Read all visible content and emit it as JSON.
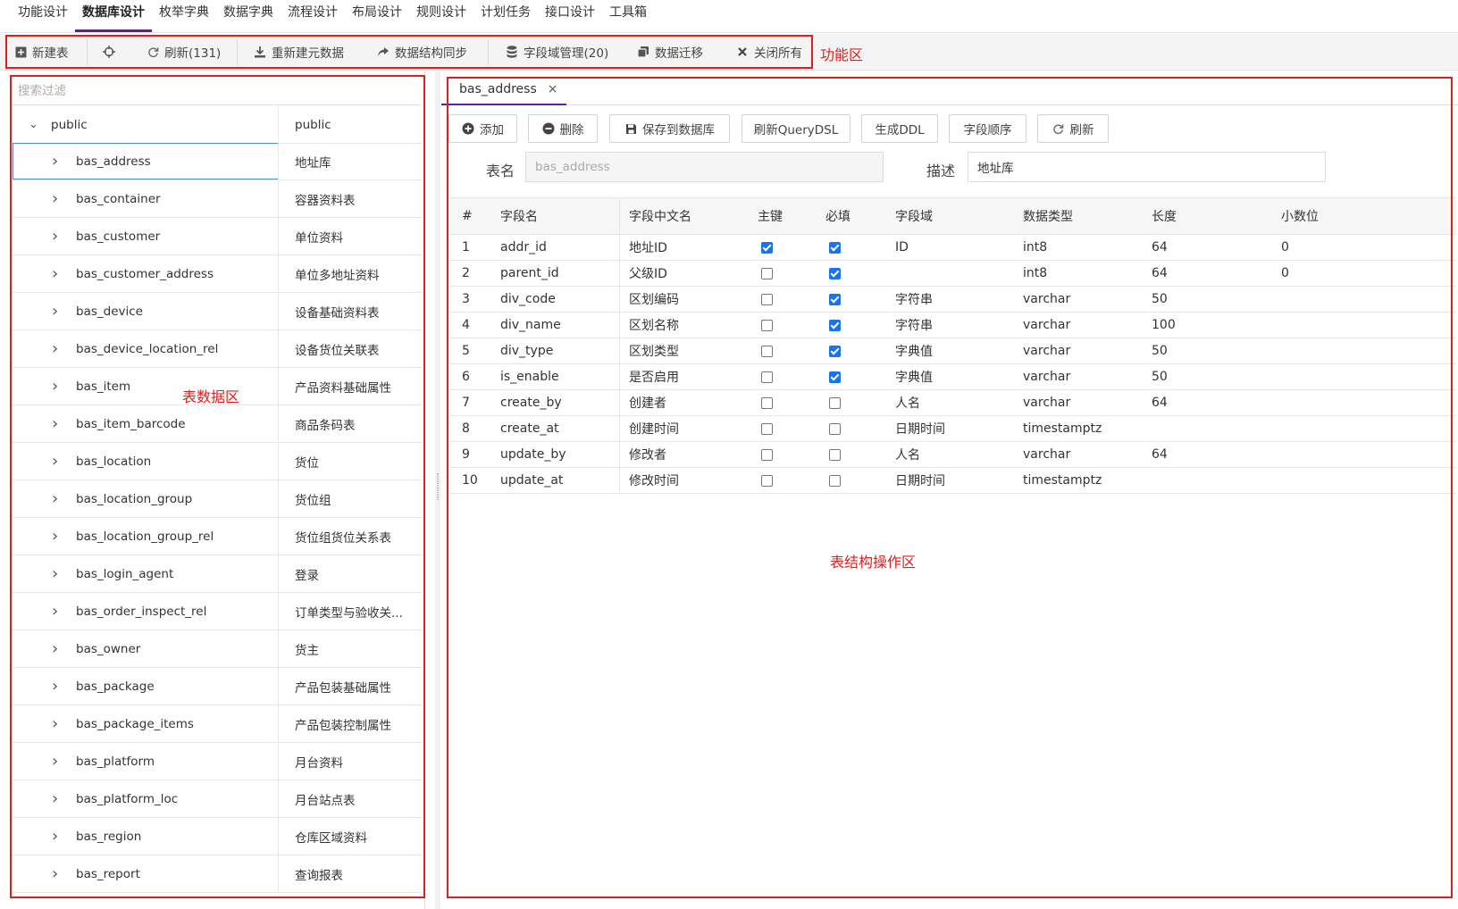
{
  "menu": [
    {
      "label": "功能设计",
      "active": false
    },
    {
      "label": "数据库设计",
      "active": true
    },
    {
      "label": "枚举字典",
      "active": false
    },
    {
      "label": "数据字典",
      "active": false
    },
    {
      "label": "流程设计",
      "active": false
    },
    {
      "label": "布局设计",
      "active": false
    },
    {
      "label": "规则设计",
      "active": false
    },
    {
      "label": "计划任务",
      "active": false
    },
    {
      "label": "接口设计",
      "active": false
    },
    {
      "label": "工具箱",
      "active": false
    }
  ],
  "toolbar": {
    "new_table": "新建表",
    "refresh": "刷新(131)",
    "rebuild_meta": "重新建元数据",
    "sync_structure": "数据结构同步",
    "field_domain": "字段域管理(20)",
    "migrate": "数据迁移",
    "close_all": "关闭所有"
  },
  "annotations": {
    "toolbar_area": "功能区",
    "table_area": "表数据区",
    "structure_area": "表结构操作区"
  },
  "tree": {
    "search_placeholder": "搜索过滤",
    "root": {
      "name": "public",
      "desc": "public"
    },
    "items": [
      {
        "name": "bas_address",
        "desc": "地址库"
      },
      {
        "name": "bas_container",
        "desc": "容器资料表"
      },
      {
        "name": "bas_customer",
        "desc": "单位资料"
      },
      {
        "name": "bas_customer_address",
        "desc": "单位多地址资料"
      },
      {
        "name": "bas_device",
        "desc": "设备基础资料表"
      },
      {
        "name": "bas_device_location_rel",
        "desc": "设备货位关联表"
      },
      {
        "name": "bas_item",
        "desc": "产品资料基础属性"
      },
      {
        "name": "bas_item_barcode",
        "desc": "商品条码表"
      },
      {
        "name": "bas_location",
        "desc": "货位"
      },
      {
        "name": "bas_location_group",
        "desc": "货位组"
      },
      {
        "name": "bas_location_group_rel",
        "desc": "货位组货位关系表"
      },
      {
        "name": "bas_login_agent",
        "desc": "登录"
      },
      {
        "name": "bas_order_inspect_rel",
        "desc": "订单类型与验收关..."
      },
      {
        "name": "bas_owner",
        "desc": "货主"
      },
      {
        "name": "bas_package",
        "desc": "产品包装基础属性"
      },
      {
        "name": "bas_package_items",
        "desc": "产品包装控制属性"
      },
      {
        "name": "bas_platform",
        "desc": "月台资料"
      },
      {
        "name": "bas_platform_loc",
        "desc": "月台站点表"
      },
      {
        "name": "bas_region",
        "desc": "仓库区域资料"
      },
      {
        "name": "bas_report",
        "desc": "查询报表"
      }
    ]
  },
  "editor": {
    "tab_label": "bas_address",
    "tab_close": "×",
    "actions": {
      "add": "添加",
      "delete": "删除",
      "save_db": "保存到数据库",
      "refresh_dsl": "刷新QueryDSL",
      "gen_ddl": "生成DDL",
      "field_order": "字段顺序",
      "refresh": "刷新"
    },
    "table_name_label": "表名",
    "table_name_value": "bas_address",
    "desc_label": "描述",
    "desc_value": "地址库"
  },
  "grid": {
    "headers": {
      "idx": "#",
      "name": "字段名",
      "cn_name": "字段中文名",
      "pk": "主键",
      "required": "必填",
      "domain": "字段域",
      "dtype": "数据类型",
      "length": "长度",
      "scale": "小数位"
    },
    "rows": [
      {
        "idx": "1",
        "name": "addr_id",
        "cn_name": "地址ID",
        "pk": true,
        "required": true,
        "domain": "ID",
        "dtype": "int8",
        "length": "64",
        "scale": "0"
      },
      {
        "idx": "2",
        "name": "parent_id",
        "cn_name": "父级ID",
        "pk": false,
        "required": true,
        "domain": "",
        "dtype": "int8",
        "length": "64",
        "scale": "0"
      },
      {
        "idx": "3",
        "name": "div_code",
        "cn_name": "区划编码",
        "pk": false,
        "required": true,
        "domain": "字符串",
        "dtype": "varchar",
        "length": "50",
        "scale": ""
      },
      {
        "idx": "4",
        "name": "div_name",
        "cn_name": "区划名称",
        "pk": false,
        "required": true,
        "domain": "字符串",
        "dtype": "varchar",
        "length": "100",
        "scale": ""
      },
      {
        "idx": "5",
        "name": "div_type",
        "cn_name": "区划类型",
        "pk": false,
        "required": true,
        "domain": "字典值",
        "dtype": "varchar",
        "length": "50",
        "scale": ""
      },
      {
        "idx": "6",
        "name": "is_enable",
        "cn_name": "是否启用",
        "pk": false,
        "required": true,
        "domain": "字典值",
        "dtype": "varchar",
        "length": "50",
        "scale": ""
      },
      {
        "idx": "7",
        "name": "create_by",
        "cn_name": "创建者",
        "pk": false,
        "required": false,
        "domain": "人名",
        "dtype": "varchar",
        "length": "64",
        "scale": ""
      },
      {
        "idx": "8",
        "name": "create_at",
        "cn_name": "创建时间",
        "pk": false,
        "required": false,
        "domain": "日期时间",
        "dtype": "timestamptz",
        "length": "",
        "scale": ""
      },
      {
        "idx": "9",
        "name": "update_by",
        "cn_name": "修改者",
        "pk": false,
        "required": false,
        "domain": "人名",
        "dtype": "varchar",
        "length": "64",
        "scale": ""
      },
      {
        "idx": "10",
        "name": "update_at",
        "cn_name": "修改时间",
        "pk": false,
        "required": false,
        "domain": "日期时间",
        "dtype": "timestamptz",
        "length": "",
        "scale": ""
      }
    ]
  },
  "colors": {
    "accent": "#6a1b9a",
    "annotation": "#e01e1e",
    "checkbox": "#1a73e8",
    "selection": "#4a90d9"
  }
}
